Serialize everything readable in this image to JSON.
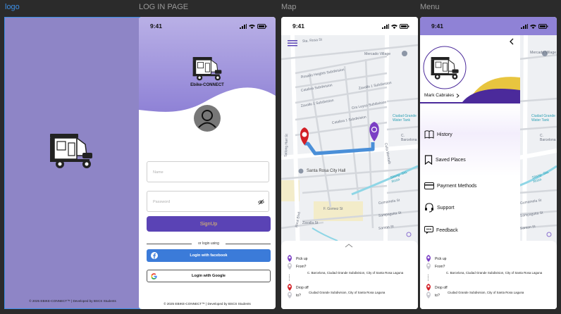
{
  "frames": {
    "logo": "logo",
    "login": "LOG IN PAGE",
    "map": "Map",
    "menu": "Menu"
  },
  "status": {
    "time": "9:41"
  },
  "logo_frame": {
    "footer": "© 2025 EBIKE-CONNECT™ | Developed by BSCS Students"
  },
  "login": {
    "app_name": "Ebike-CONNECT",
    "name_placeholder": "Name",
    "password_placeholder": "Password",
    "signup_label": "SignUp",
    "or_text": "or login  using",
    "facebook_label": "Login with facebook",
    "google_label": "Login with Google",
    "footer": "© 2025 EBIKE-CONNECT™ | Developed by BSCS Students"
  },
  "map": {
    "labels": {
      "mercado": "Mercado Village",
      "rosario": "Rosario Heights Subdivision",
      "catalina": "Catalina Subdivision",
      "zavalla1": "Zavalla 1 Subdivision",
      "catalina2": "Catalina 1 Subdivision",
      "villa_leyco": "Gra Leyco Subdivision",
      "zavalla_sub": "Zavalla 1 Subdivision",
      "tatlong_hari": "Tatlong Hari St",
      "city_hall": "Santa Rosa City Hall",
      "water_tank": "Ciudad Grande Water Tank",
      "ciudad": "Ciudad Grande Subdivision",
      "c_barcelona": "C. Barcelona",
      "gomez": "F. Gomez St",
      "zavalla_st": "Zavalla St",
      "rizal": "Rizal Blvd",
      "gumamela": "Gumamela St",
      "sampaguita": "Sampaguita St",
      "santan": "Santan St",
      "silang": "Silang- Sta. Rosa",
      "canal": "Culla Montalb",
      "strolla": "Sta. Rosa St"
    },
    "pickup_label": "Pick up",
    "from_label": "From?",
    "from_value": "C. Barcelona, Ciudad Grande Subdivision, City of Santa Rosa Laguna",
    "dropoff_label": "Drop off",
    "to_label": "to?",
    "to_value": "Ciudad Grande Subdivision, City of Santa Rosa Laguna"
  },
  "menu": {
    "user_name": "Mark Cabrales",
    "items": [
      "History",
      "Saved Places",
      "Payment Methods",
      "Support",
      "Feedback"
    ]
  },
  "colors": {
    "brand_purple": "#5a43b5",
    "logo_bg": "#8e85c6",
    "pin_red": "#d21f26",
    "pin_purple": "#7b3fc4",
    "route_blue": "#4a8fd8"
  }
}
